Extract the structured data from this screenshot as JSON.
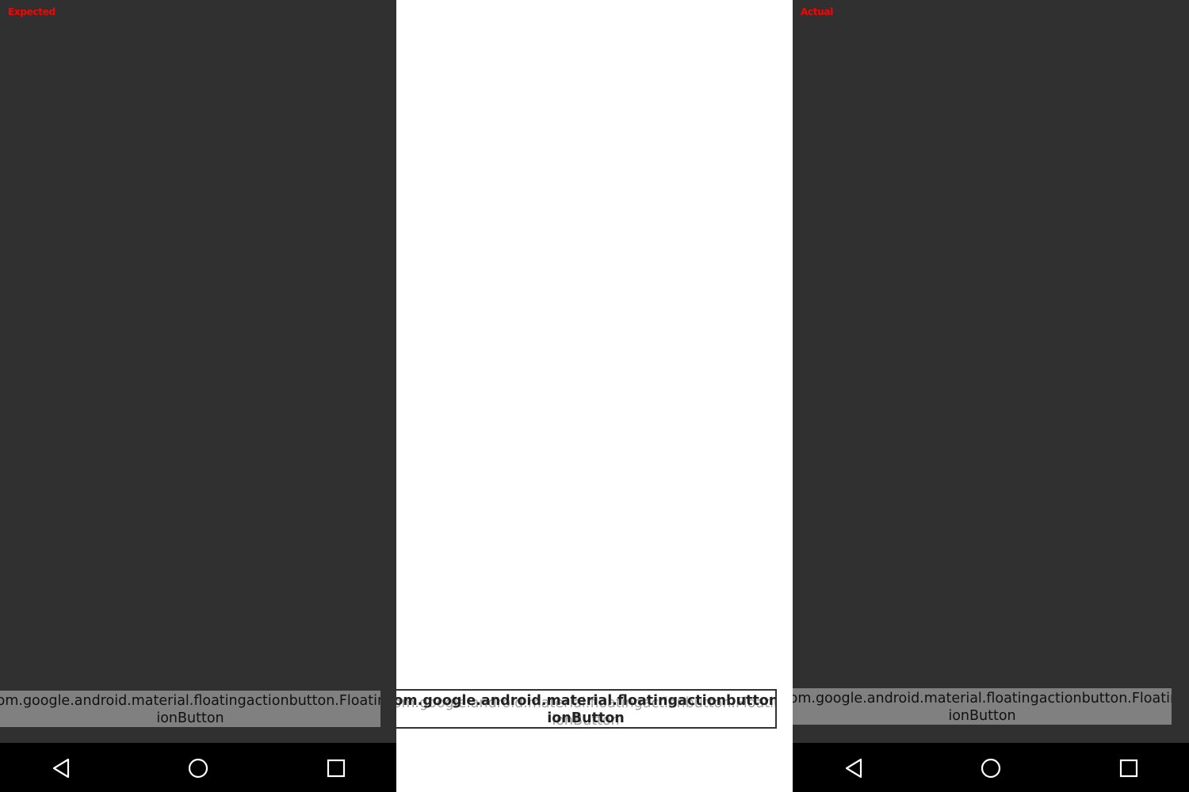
{
  "panels": {
    "expected": {
      "label": "Expected"
    },
    "actual": {
      "label": "Actual"
    }
  },
  "toast": {
    "line1": "com.google.android.material.floatingactionbutton.FloatingAct",
    "line2": "ionButton"
  },
  "navbar": {
    "back": "back-icon",
    "home": "home-icon",
    "recent": "recent-apps-icon"
  },
  "colors": {
    "panel_background": "#303030",
    "toast_background": "#808080",
    "label_color": "#ff0000",
    "navbar_background": "#000000",
    "diff_background": "#ffffff"
  }
}
